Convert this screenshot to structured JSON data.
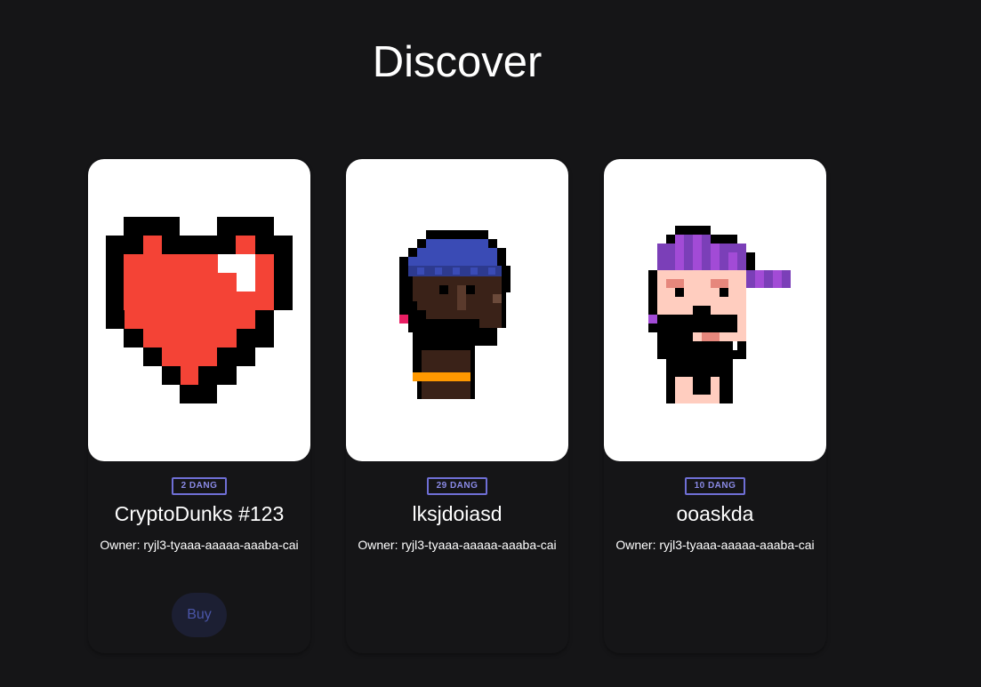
{
  "header": {
    "title": "Discover"
  },
  "cards": [
    {
      "badge": "2 DANG",
      "name": "CryptoDunks #123",
      "owner": "Owner: ryjl3-tyaaa-aaaaa-aaaba-cai",
      "buy_label": "Buy",
      "image": "pixel-heart"
    },
    {
      "badge": "29 DANG",
      "name": "lksjdoiasd",
      "owner": "Owner: ryjl3-tyaaa-aaaaa-aaaba-cai",
      "image": "pixel-punk-beanie"
    },
    {
      "badge": "10 DANG",
      "name": "ooaskda",
      "owner": "Owner: ryjl3-tyaaa-aaaaa-aaaba-cai",
      "image": "pixel-punk-cap"
    }
  ],
  "colors": {
    "background": "#151517",
    "badge": "#6f6fd6",
    "buy_bg": "#1c1f33",
    "buy_text": "#4a55a8"
  }
}
